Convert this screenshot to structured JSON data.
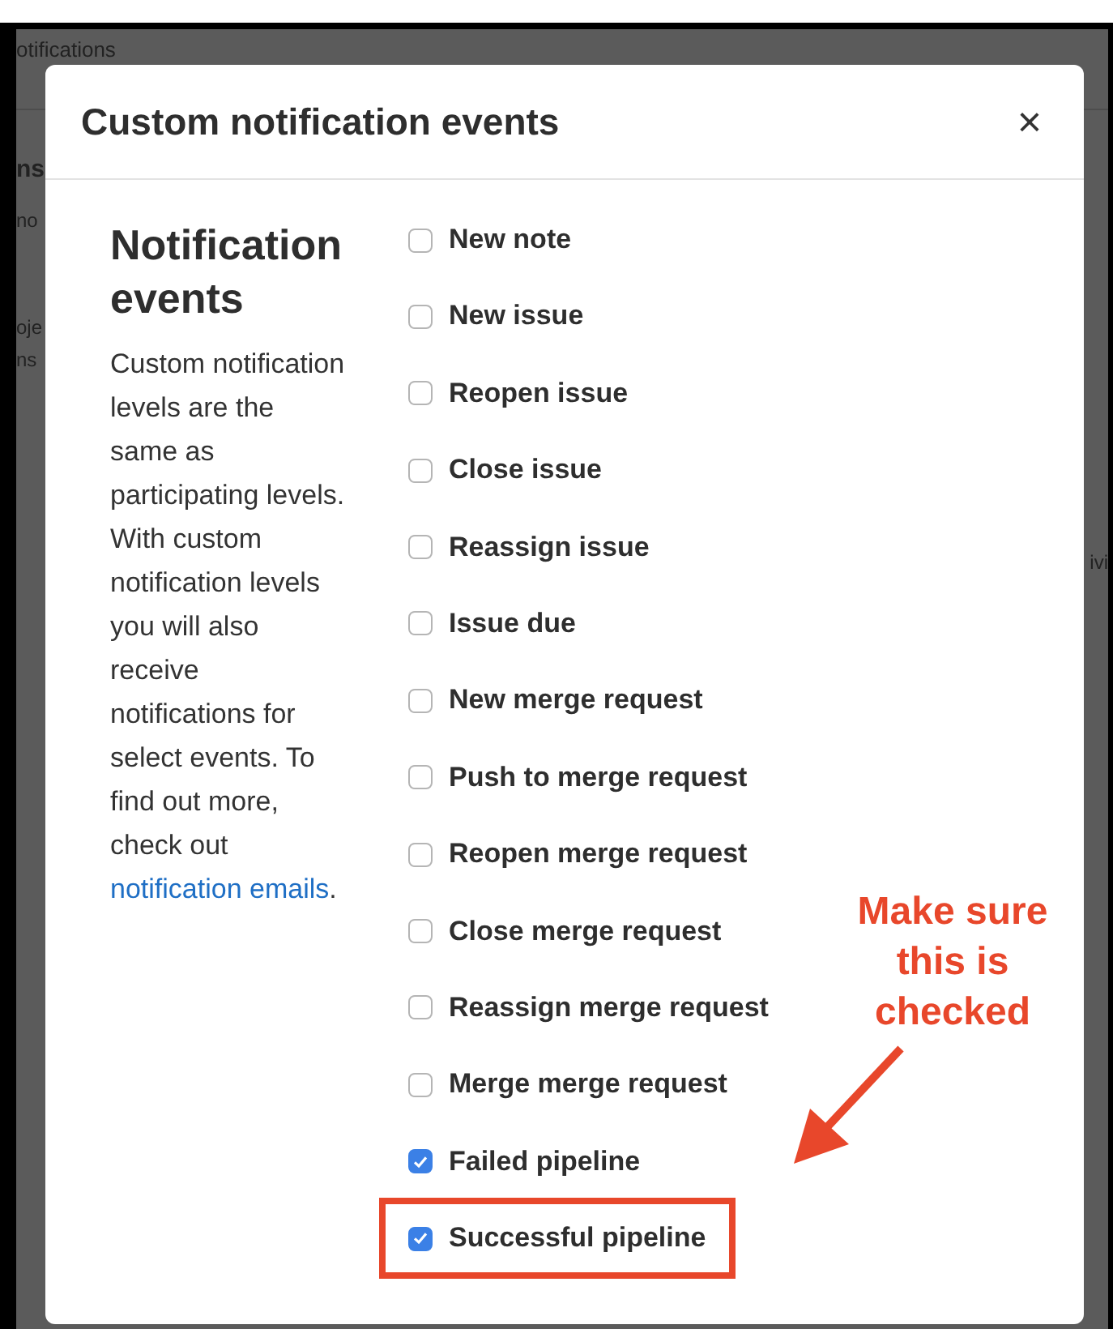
{
  "background": {
    "header": "otifications",
    "fragments_left": [
      "ns",
      "no",
      "oje",
      "ns"
    ],
    "fragment_right": "ivi"
  },
  "modal": {
    "title": "Custom notification events",
    "close": "×",
    "heading": "Notification events",
    "description": {
      "text": "Custom notification levels are the same as participating levels. With custom notification levels you will also receive notifications for select events. To find out more, check out",
      "link": "notification emails",
      "after": "."
    },
    "events": [
      {
        "label": "New note",
        "checked": false,
        "highlighted": false
      },
      {
        "label": "New issue",
        "checked": false,
        "highlighted": false
      },
      {
        "label": "Reopen issue",
        "checked": false,
        "highlighted": false
      },
      {
        "label": "Close issue",
        "checked": false,
        "highlighted": false
      },
      {
        "label": "Reassign issue",
        "checked": false,
        "highlighted": false
      },
      {
        "label": "Issue due",
        "checked": false,
        "highlighted": false
      },
      {
        "label": "New merge request",
        "checked": false,
        "highlighted": false
      },
      {
        "label": "Push to merge request",
        "checked": false,
        "highlighted": false
      },
      {
        "label": "Reopen merge request",
        "checked": false,
        "highlighted": false
      },
      {
        "label": "Close merge request",
        "checked": false,
        "highlighted": false
      },
      {
        "label": "Reassign merge request",
        "checked": false,
        "highlighted": false
      },
      {
        "label": "Merge merge request",
        "checked": false,
        "highlighted": false
      },
      {
        "label": "Failed pipeline",
        "checked": true,
        "highlighted": false
      },
      {
        "label": "Successful pipeline",
        "checked": true,
        "highlighted": true
      }
    ]
  },
  "annotation": {
    "text": "Make sure this is checked"
  }
}
